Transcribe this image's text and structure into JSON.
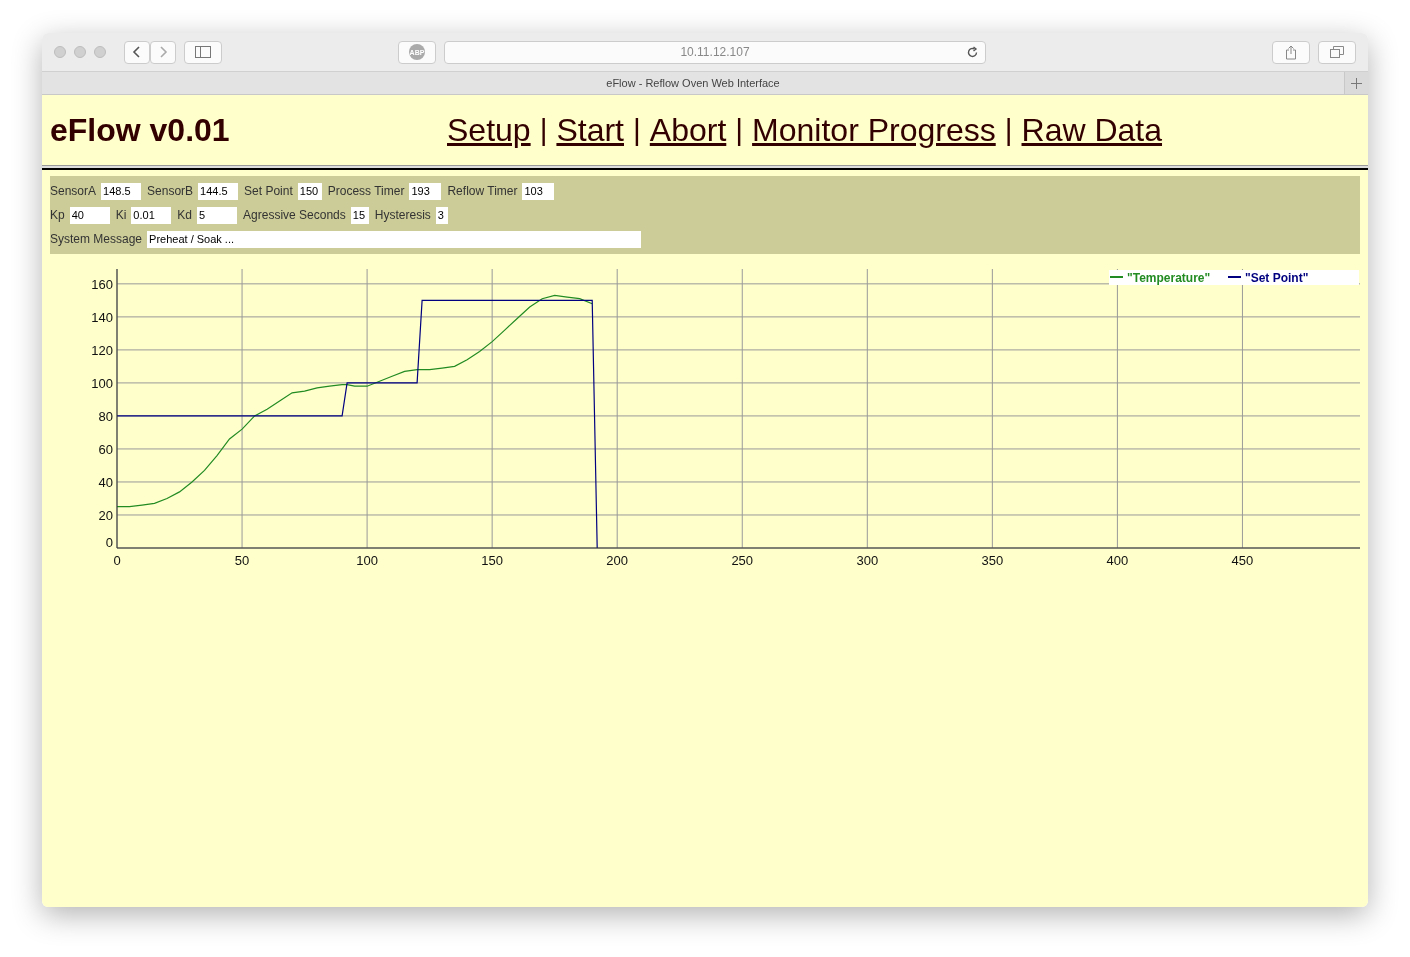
{
  "browser": {
    "address": "10.11.12.107",
    "tab_title": "eFlow - Reflow Oven Web Interface",
    "adblock_label": "ABP"
  },
  "header": {
    "title": "eFlow v0.01",
    "links": [
      "Setup",
      "Start",
      "Abort",
      "Monitor Progress",
      "Raw Data"
    ],
    "separator": "|"
  },
  "status_rows": [
    [
      {
        "label": "SensorA",
        "value": "148.5"
      },
      {
        "label": "SensorB",
        "value": "144.5"
      },
      {
        "label": "Set Point",
        "value": "150"
      },
      {
        "label": "Process Timer",
        "value": "193"
      },
      {
        "label": "Reflow Timer",
        "value": "103"
      }
    ],
    [
      {
        "label": "Kp",
        "value": "40"
      },
      {
        "label": "Ki",
        "value": "0.01"
      },
      {
        "label": "Kd",
        "value": "5"
      },
      {
        "label": "Agressive Seconds",
        "value": "15"
      },
      {
        "label": "Hysteresis",
        "value": "3"
      }
    ],
    [
      {
        "label": "System Message",
        "value": "Preheat / Soak ..."
      }
    ]
  ],
  "chart_data": {
    "type": "line",
    "grid": true,
    "legend": "upper right",
    "x": [
      0,
      5,
      10,
      15,
      20,
      25,
      30,
      35,
      40,
      45,
      50,
      55,
      60,
      65,
      70,
      75,
      80,
      85,
      90,
      92,
      95,
      100,
      105,
      110,
      115,
      120,
      122,
      125,
      130,
      135,
      140,
      145,
      150,
      155,
      160,
      165,
      170,
      175,
      180,
      185,
      190,
      192
    ],
    "xlim": [
      0,
      497
    ],
    "ylim": [
      0,
      169
    ],
    "xticks": [
      0,
      50,
      100,
      150,
      200,
      250,
      300,
      350,
      400,
      450
    ],
    "yticks": [
      0,
      20,
      40,
      60,
      80,
      100,
      120,
      140,
      160
    ],
    "series": [
      {
        "name": "\"Temperature\"",
        "color": "#228b22",
        "values": [
          25,
          25,
          26,
          27,
          30,
          34,
          40,
          47,
          56,
          66,
          72,
          80,
          84,
          89,
          94,
          95,
          97,
          98,
          99,
          99,
          98,
          98,
          101,
          104,
          107,
          108,
          108,
          108,
          109,
          110,
          114,
          119,
          125,
          132,
          139,
          146,
          151,
          153,
          152,
          151,
          148,
          null
        ]
      },
      {
        "name": "\"Set Point\"",
        "color": "#000080",
        "values": [
          80,
          80,
          80,
          80,
          80,
          80,
          80,
          80,
          80,
          80,
          80,
          80,
          80,
          80,
          80,
          80,
          80,
          80,
          80,
          100,
          100,
          100,
          100,
          100,
          100,
          100,
          150,
          150,
          150,
          150,
          150,
          150,
          150,
          150,
          150,
          150,
          150,
          150,
          150,
          150,
          150,
          0
        ]
      }
    ]
  }
}
